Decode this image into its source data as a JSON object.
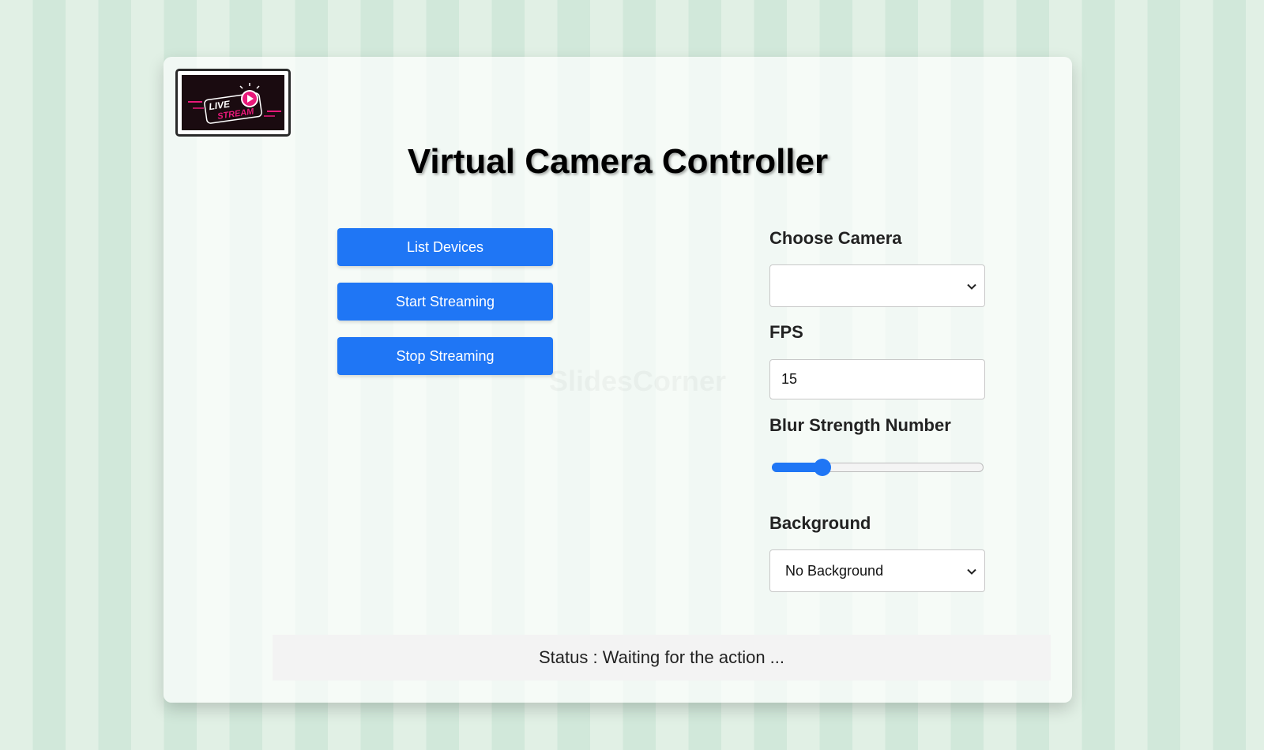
{
  "logo": {
    "name": "live-stream-logo",
    "text_line1": "LIVE",
    "text_line2": "STREAM"
  },
  "title": "Virtual Camera Controller",
  "watermark": "SlidesCorner",
  "buttons": {
    "list_devices": "List Devices",
    "start_streaming": "Start Streaming",
    "stop_streaming": "Stop Streaming"
  },
  "controls": {
    "camera_label": "Choose Camera",
    "camera_selected": "",
    "fps_label": "FPS",
    "fps_value": "15",
    "blur_label": "Blur Strength Number",
    "blur_value_fraction": 0.24,
    "background_label": "Background",
    "background_selected": "No Background"
  },
  "status": "Status : Waiting for the action ...",
  "colors": {
    "accent": "#1f76f5",
    "stripe_light": "#e1f0e5",
    "stripe_dark": "#d1e8da",
    "logo_pink": "#e8197a"
  }
}
